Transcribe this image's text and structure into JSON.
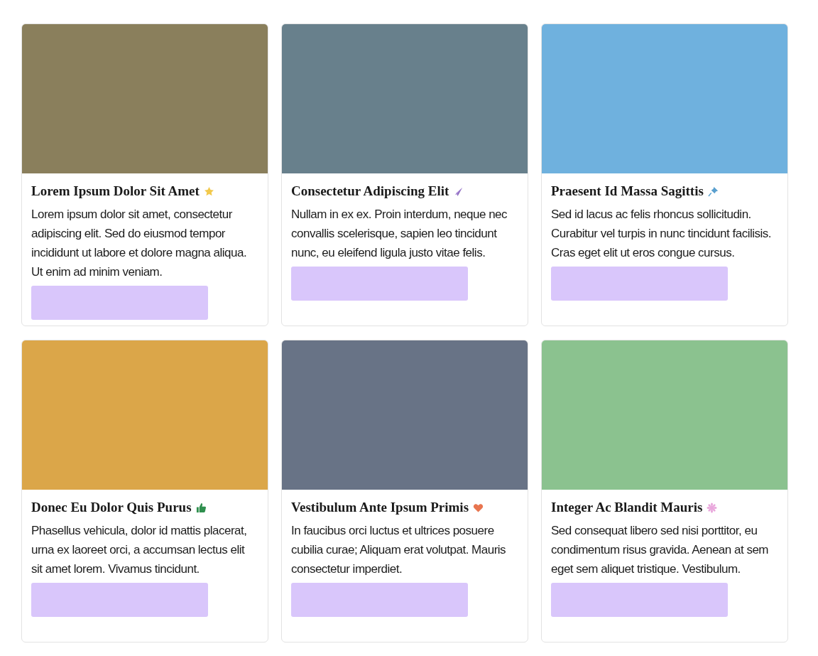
{
  "cards": [
    {
      "color": "#8a7f5c",
      "title": "Lorem Ipsum Dolor Sit Amet",
      "text": "Lorem ipsum dolor sit amet, consectetur adipiscing elit. Sed do eiusmod tempor incididunt ut labore et dolore magna aliqua. Ut enim ad minim veniam."
    },
    {
      "color": "#68808c",
      "title": "Consectetur Adipiscing Elit",
      "text": "Nullam in ex ex. Proin interdum, neque nec convallis scelerisque, sapien leo tincidunt nunc, eu eleifend ligula justo vitae felis."
    },
    {
      "color": "#6fb1de",
      "title": "Praesent Id Massa Sagittis",
      "text": "Sed id lacus ac felis rhoncus sollicitudin. Curabitur vel turpis in nunc tincidunt facilisis. Cras eget elit ut eros congue cursus."
    },
    {
      "color": "#dba649",
      "title": "Donec Eu Dolor Quis Purus",
      "text": "Phasellus vehicula, dolor id mattis placerat, urna ex laoreet orci, a accumsan lectus elit sit amet lorem. Vivamus tincidunt."
    },
    {
      "color": "#687386",
      "title": "Vestibulum Ante Ipsum Primis",
      "text": "In faucibus orci luctus et ultrices posuere cubilia curae; Aliquam erat volutpat. Mauris consectetur imperdiet."
    },
    {
      "color": "#8bc28f",
      "title": "Integer Ac Blandit Mauris",
      "text": "Sed consequat libero sed nisi porttitor, eu condimentum risus gravida. Aenean at sem eget sem aliquet tristique. Vestibulum."
    }
  ]
}
